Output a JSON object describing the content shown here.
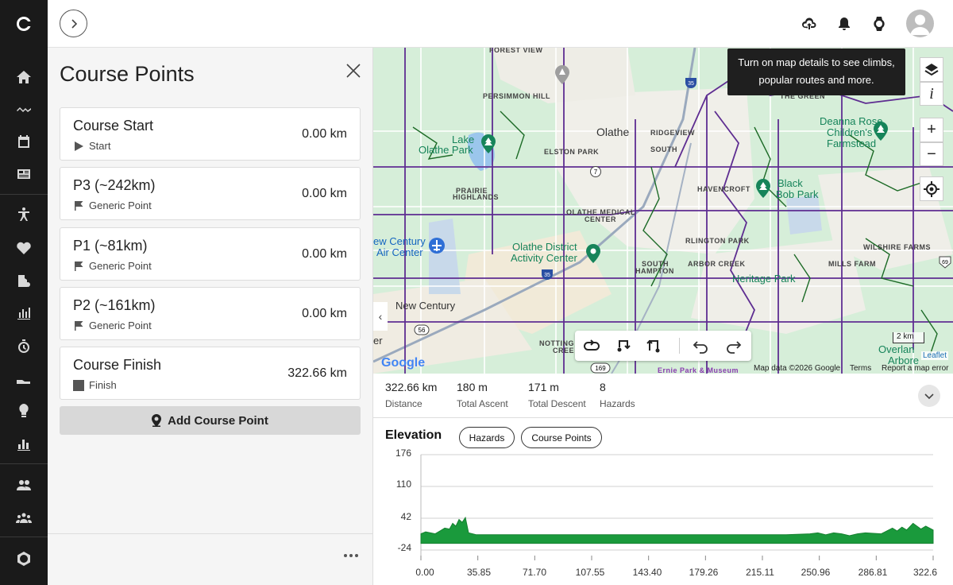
{
  "nav": {
    "logo": "connect-logo",
    "icons": [
      "home-icon",
      "activity-trend-icon",
      "calendar-icon",
      "news-feed-icon",
      "training-icon",
      "health-icon",
      "gear-shoe-icon",
      "reports-icon",
      "timer-icon",
      "segments-shoe-icon",
      "insights-bulb-icon",
      "stats-bar-icon",
      "connections-icon",
      "groups-icon",
      "badges-icon"
    ]
  },
  "topbar": {
    "expand_icon": "chevron-right-icon",
    "upload_icon": "cloud-upload-icon",
    "notifications_icon": "bell-icon",
    "device_icon": "watch-icon",
    "avatar_icon": "user-avatar-icon"
  },
  "panel": {
    "title": "Course Points",
    "add_button": "Add Course Point",
    "points": [
      {
        "name": "Course Start",
        "type": "Start",
        "distance": "0.00 km",
        "icon": "play-flag-icon"
      },
      {
        "name": "P3 (~242km)",
        "type": "Generic Point",
        "distance": "0.00 km",
        "icon": "flag-icon"
      },
      {
        "name": "P1 (~81km)",
        "type": "Generic Point",
        "distance": "0.00 km",
        "icon": "flag-icon"
      },
      {
        "name": "P2 (~161km)",
        "type": "Generic Point",
        "distance": "0.00 km",
        "icon": "flag-icon"
      },
      {
        "name": "Course Finish",
        "type": "Finish",
        "distance": "322.66 km",
        "icon": "finish-square-icon"
      }
    ]
  },
  "map": {
    "tooltip": "Turn on map details to see climbs, popular routes and more.",
    "labels": {
      "forest_view": "FOREST VIEW",
      "persimmon_hill": "PERSIMMON HILL",
      "lake_olathe_1": "Lake",
      "lake_olathe_2": "Olathe Park",
      "olathe": "Olathe",
      "ridgeview_1": "RIDGEVIEW",
      "ridgeview_2": "SOUTH",
      "elston_park": "ELSTON PARK",
      "deanna_1": "Deanna Rose",
      "deanna_2": "Children's",
      "deanna_3": "Farmstead",
      "prairie_1": "PRAIRIE",
      "prairie_2": "HIGHLANDS",
      "havencroft": "HAVENCROFT",
      "black_bob_1": "Black",
      "black_bob_2": "Bob Park",
      "olathe_med_1": "OLATHE MEDICAL",
      "olathe_med_2": "CENTER",
      "new_century_air_1": "ew Century",
      "new_century_air_2": "Air Center",
      "olathe_district_1": "Olathe District",
      "olathe_district_2": "Activity Center",
      "arlington_park": "RLINGTON PARK",
      "wilshire_farms": "WILSHIRE FARMS",
      "south_hampton_1": "SOUTH",
      "south_hampton_2": "HAMPTON",
      "arbor_creek": "ARBOR CREEK",
      "mills_farm": "MILLS FARM",
      "heritage_park": "Heritage Park",
      "new_century": "New Century",
      "nottingham_1": "NOTTING",
      "nottingham_2": "CREE",
      "overland_1": "Overlan",
      "overland_2": "Arbore",
      "er": "er",
      "the_green": "THE GREEN",
      "ernie_park": "Ernie Park & Museum"
    },
    "shields": {
      "i35_a": "35",
      "i35_b": "35",
      "r7": "7",
      "r169": "169",
      "r56": "56",
      "us69": "69"
    },
    "scale": "2 km",
    "attribution": {
      "map_data": "Map data ©2026 Google",
      "terms": "Terms",
      "report": "Report a map error",
      "leaflet": "Leaflet",
      "google": "Google"
    },
    "controls": {
      "layers": "layers-icon",
      "info": "i",
      "zoom_in": "+",
      "zoom_out": "−",
      "locate": "locate-icon"
    },
    "toolbar": [
      "loop-route-icon",
      "out-back-icon",
      "reverse-route-icon",
      "undo-icon",
      "redo-icon"
    ]
  },
  "stats": [
    {
      "value": "322.66 km",
      "label": "Distance"
    },
    {
      "value": "180 m",
      "label": "Total Ascent"
    },
    {
      "value": "171 m",
      "label": "Total Descent"
    },
    {
      "value": "8",
      "label": "Hazards"
    }
  ],
  "elevation": {
    "title": "Elevation",
    "filters": [
      "Hazards",
      "Course Points"
    ],
    "yticks": [
      "176",
      "110",
      "42",
      "-24"
    ],
    "xticks": [
      "0.00",
      "35.85",
      "71.70",
      "107.55",
      "143.40",
      "179.26",
      "215.11",
      "250.96",
      "286.81",
      "322.6"
    ],
    "fill_color": "#1a9a3c",
    "profile": {
      "x_km": [
        0,
        3,
        6,
        9,
        12,
        15,
        18,
        20,
        22,
        24,
        26,
        28,
        30,
        35,
        50,
        100,
        150,
        200,
        230,
        245,
        250,
        255,
        260,
        265,
        270,
        275,
        280,
        290,
        297,
        300,
        303,
        306,
        310,
        315,
        318,
        322.66
      ],
      "elev_m": [
        10,
        14,
        12,
        10,
        16,
        22,
        20,
        32,
        26,
        40,
        34,
        44,
        12,
        8,
        8,
        8,
        8,
        8,
        8,
        10,
        12,
        8,
        12,
        10,
        6,
        10,
        12,
        10,
        22,
        16,
        24,
        18,
        32,
        20,
        26,
        18
      ]
    }
  }
}
